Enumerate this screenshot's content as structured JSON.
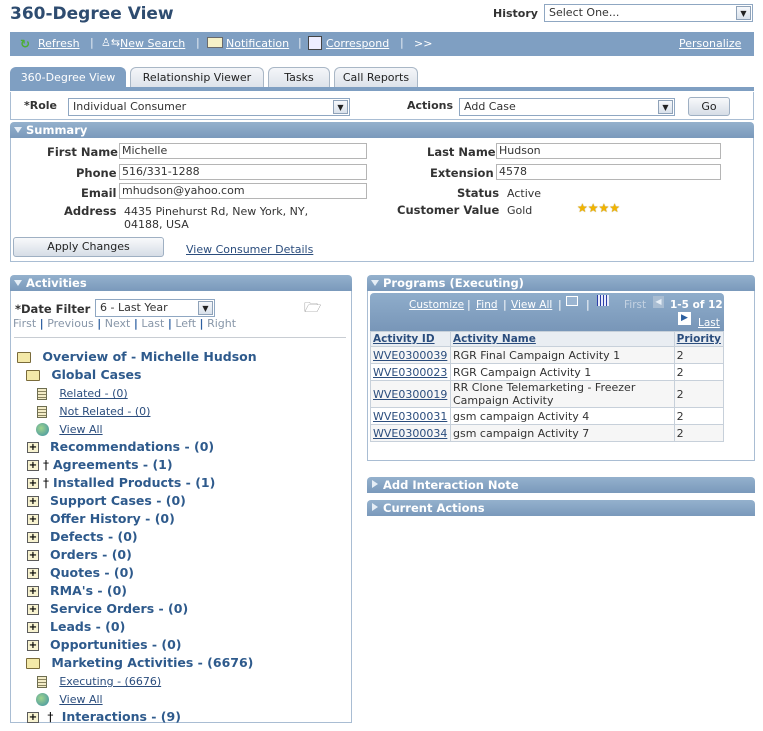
{
  "page": {
    "title": "360-Degree View"
  },
  "history": {
    "label": "History",
    "value": "Select One..."
  },
  "toolbar": {
    "items": [
      {
        "label": "Refresh",
        "icon": "refresh-icon"
      },
      {
        "label": "New Search",
        "icon": "new-search-icon"
      },
      {
        "label": "Notification",
        "icon": "notification-icon"
      },
      {
        "label": "Correspond",
        "icon": "correspond-icon"
      }
    ],
    "more": ">>",
    "personalize": "Personalize"
  },
  "tabs": [
    {
      "label": "360-Degree View",
      "active": true
    },
    {
      "label": "Relationship Viewer"
    },
    {
      "label": "Tasks"
    },
    {
      "label": "Call Reports"
    }
  ],
  "role": {
    "label": "*Role",
    "value": "Individual Consumer"
  },
  "actions": {
    "label": "Actions",
    "value": "Add Case",
    "go": "Go"
  },
  "summary": {
    "title": "Summary",
    "first_name_label": "First Name",
    "first_name": "Michelle",
    "last_name_label": "Last Name",
    "last_name": "Hudson",
    "phone_label": "Phone",
    "phone": "516/331-1288",
    "extension_label": "Extension",
    "extension": "4578",
    "email_label": "Email",
    "email": "mhudson@yahoo.com",
    "status_label": "Status",
    "status": "Active",
    "address_label": "Address",
    "address_line1": "4435 Pinehurst Rd, New York, NY,",
    "address_line2": "04188, USA",
    "customer_value_label": "Customer Value",
    "customer_value": "Gold",
    "stars": 4,
    "apply_changes": "Apply Changes",
    "view_details": "View Consumer Details"
  },
  "activities": {
    "title": "Activities",
    "date_filter_label": "*Date Filter",
    "date_filter_value": "6 - Last Year",
    "nav": [
      "First",
      "Previous",
      "Next",
      "Last",
      "Left",
      "Right"
    ],
    "root": "Overview of - Michelle Hudson",
    "global_cases": "Global Cases",
    "related": "Related - (0)",
    "not_related": "Not Related - (0)",
    "view_all": "View All",
    "nodes": [
      {
        "label": "Recommendations - (0)",
        "dagger": false
      },
      {
        "label": "Agreements - (1)",
        "dagger": true
      },
      {
        "label": "Installed Products - (1)",
        "dagger": true
      },
      {
        "label": "Support Cases - (0)",
        "dagger": false
      },
      {
        "label": "Offer History - (0)",
        "dagger": false
      },
      {
        "label": "Defects - (0)",
        "dagger": false
      },
      {
        "label": "Orders - (0)",
        "dagger": false
      },
      {
        "label": "Quotes - (0)",
        "dagger": false
      },
      {
        "label": "RMA's - (0)",
        "dagger": false
      },
      {
        "label": "Service Orders - (0)",
        "dagger": false
      },
      {
        "label": "Leads - (0)",
        "dagger": false
      },
      {
        "label": "Opportunities - (0)",
        "dagger": false
      }
    ],
    "marketing": "Marketing Activities - (6676)",
    "executing": "Executing - (6676)",
    "view_all_2": "View All",
    "interactions": "Interactions - (9)",
    "dagger_char": "†"
  },
  "programs": {
    "title": "Programs (Executing)",
    "customize": "Customize",
    "find": "Find",
    "view_all": "View All",
    "first": "First",
    "range": "1-5 of 12",
    "last": "Last",
    "columns": [
      "Activity ID",
      "Activity Name",
      "Priority"
    ],
    "rows": [
      {
        "id": "WVE0300039",
        "name": "RGR Final Campaign Activity 1",
        "priority": "2"
      },
      {
        "id": "WVE0300023",
        "name": "RGR Campaign Activity 1",
        "priority": "2"
      },
      {
        "id": "WVE0300019",
        "name": "RR Clone Telemarketing - Freezer Campaign Activity",
        "priority": "2"
      },
      {
        "id": "WVE0300031",
        "name": "gsm campaign Activity 4",
        "priority": "2"
      },
      {
        "id": "WVE0300034",
        "name": "gsm campaign Activity 7",
        "priority": "2"
      }
    ]
  },
  "collapsed_panels": [
    "Add Interaction Note",
    "Current Actions"
  ]
}
